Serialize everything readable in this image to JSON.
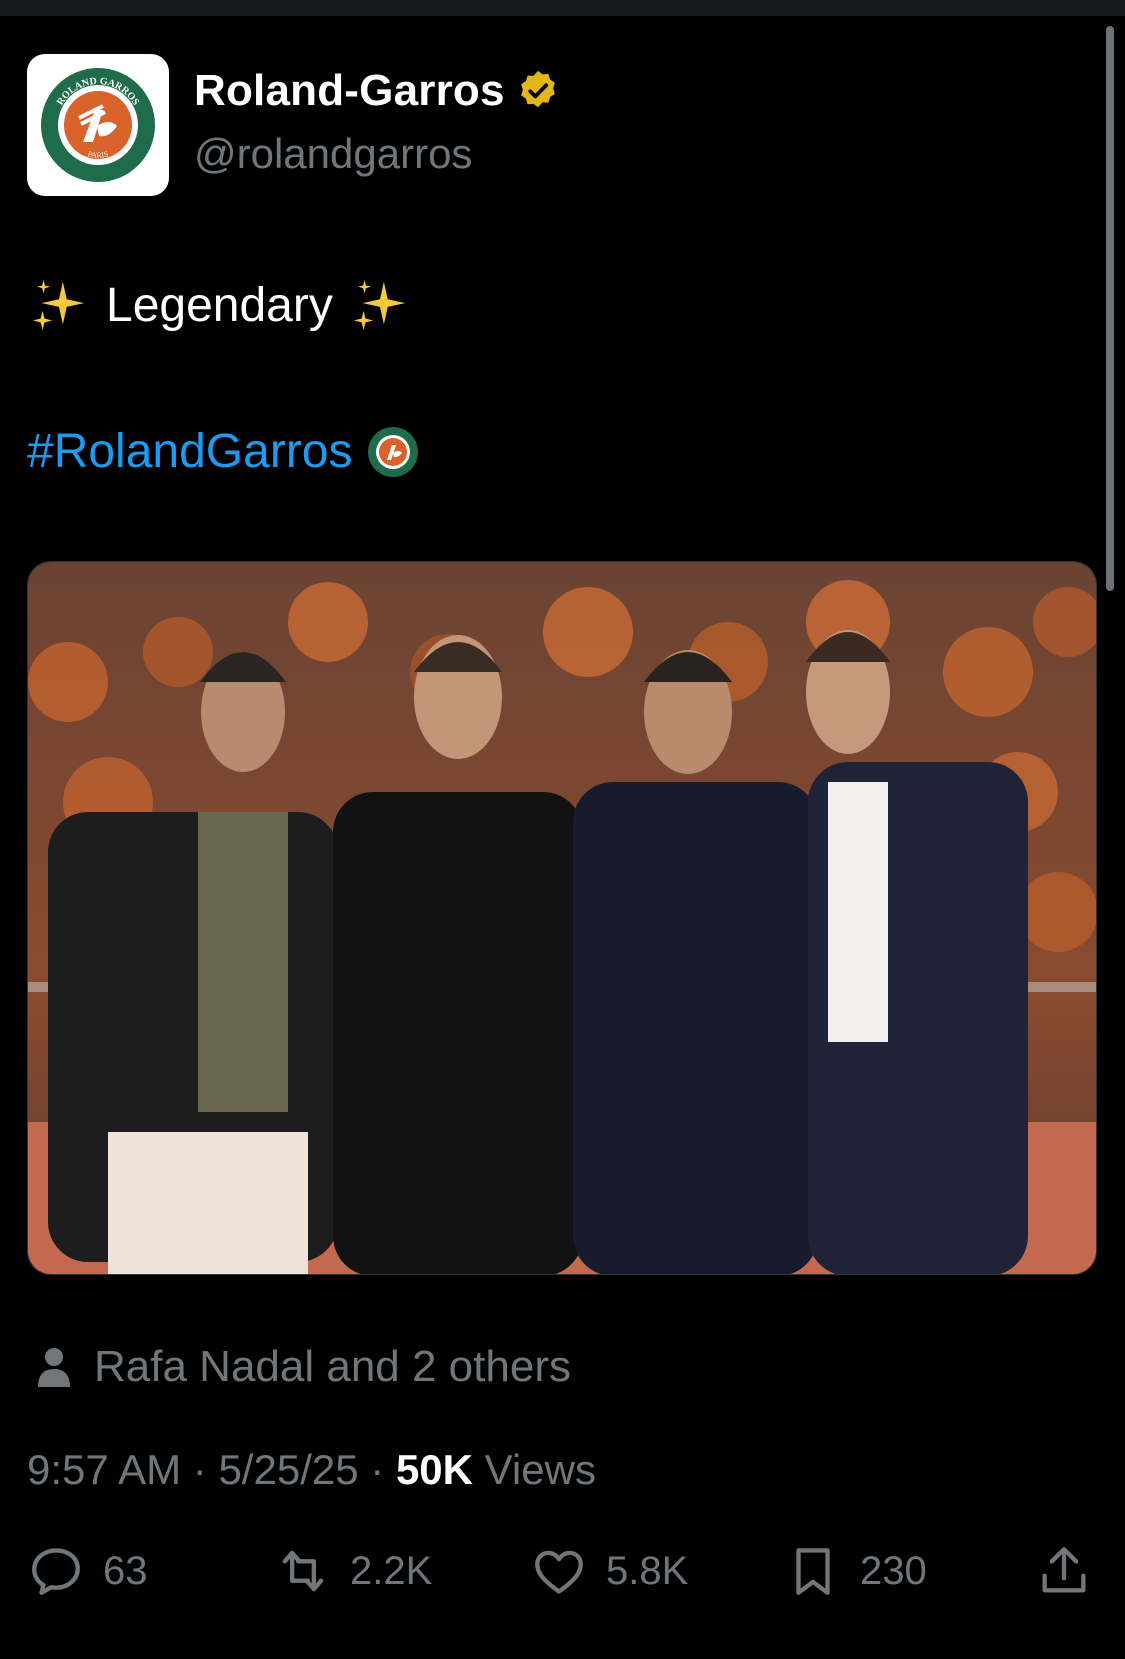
{
  "account": {
    "name": "Roland-Garros",
    "handle": "@rolandgarros",
    "logo_text": "ROLAND GARROS",
    "logo_subtext": "PARIS",
    "verified_color": "#e2b719"
  },
  "tweet": {
    "text": "Legendary",
    "sparkle_icon": "sparkles-emoji",
    "hashtag": "#RolandGarros",
    "hashtag_color": "#1d9bf0"
  },
  "media": {
    "alt_subject": "photo",
    "icon": "photo"
  },
  "tagged": {
    "text": "Rafa Nadal and 2 others"
  },
  "meta": {
    "time": "9:57 AM",
    "date": "5/25/25",
    "separator": "·",
    "views_count": "50K",
    "views_label": "Views"
  },
  "actions": {
    "replies": "63",
    "reposts": "2.2K",
    "likes": "5.8K",
    "bookmarks": "230"
  },
  "colors": {
    "background": "#000000",
    "muted": "#71767b",
    "brand_green": "#1f6b4a",
    "brand_orange": "#d9622b"
  }
}
